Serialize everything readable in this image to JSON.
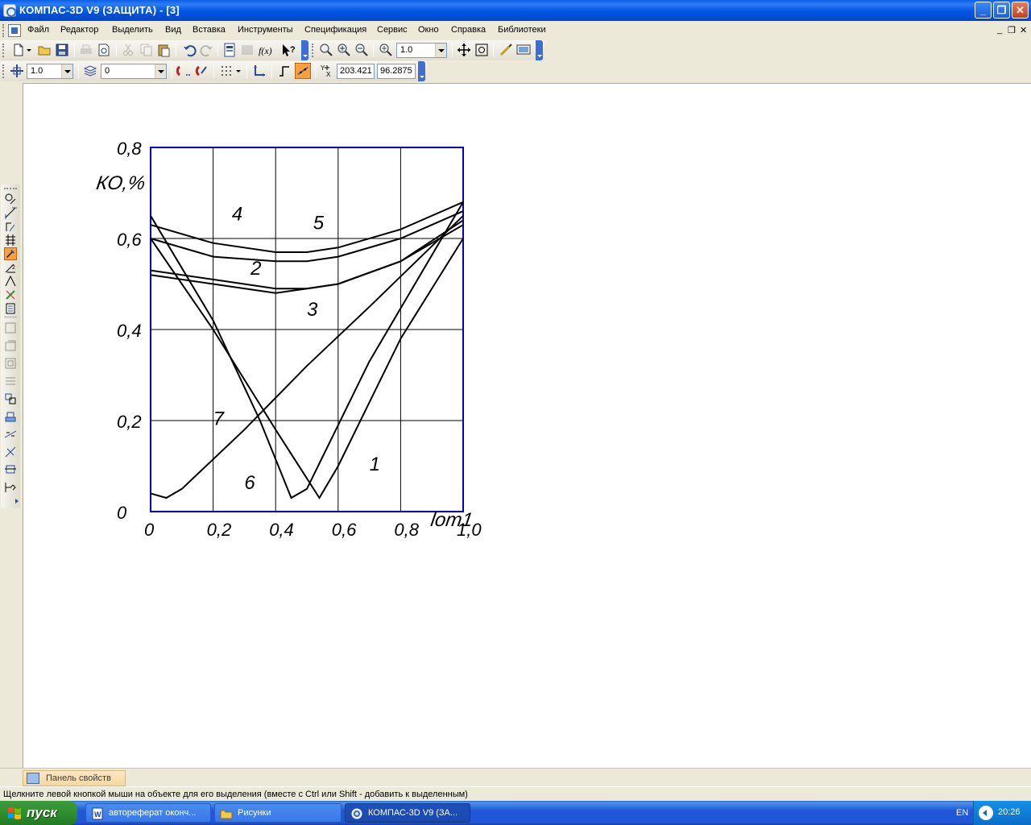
{
  "window": {
    "title": "КОМПАС-3D V9 (ЗАЩИТА) - [3]",
    "buttons": {
      "minimize": "_",
      "restore": "❐",
      "close": "✕"
    }
  },
  "menu": {
    "items": [
      "Файл",
      "Редактор",
      "Выделить",
      "Вид",
      "Вставка",
      "Инструменты",
      "Спецификация",
      "Сервис",
      "Окно",
      "Справка",
      "Библиотеки"
    ]
  },
  "toolbar_standard": {
    "zoom_value": "1.0"
  },
  "toolbar_current_state": {
    "step_value": "1.0",
    "layer_value": "0",
    "coord_x": "203.421",
    "coord_y": "96.2875"
  },
  "properties_panel": {
    "tab_label": "Панель свойств"
  },
  "status_bar": {
    "message": "Щелкните левой кнопкой мыши на объекте для его выделения (вместе с Ctrl или Shift - добавить к выделенным)"
  },
  "taskbar": {
    "start_label": "пуск",
    "tasks": [
      {
        "label": "автореферат оконч..."
      },
      {
        "label": "Рисунки"
      },
      {
        "label": "КОМПАС-3D V9 (ЗА..."
      }
    ],
    "language": "EN",
    "clock": "20:26"
  },
  "chart_data": {
    "type": "line",
    "ylabel": "КО,%",
    "xlabel": "lom1",
    "xlim": [
      0,
      1.0
    ],
    "ylim": [
      0,
      0.8
    ],
    "x_ticks": [
      "0",
      "0,2",
      "0,4",
      "0,6",
      "0,8",
      "1,0"
    ],
    "y_ticks": [
      "0",
      "0,2",
      "0,4",
      "0,6",
      "0,8"
    ],
    "grid": true,
    "series": [
      {
        "name": "1",
        "points": [
          [
            0,
            0.6
          ],
          [
            0.2,
            0.4
          ],
          [
            0.4,
            0.18
          ],
          [
            0.54,
            0.03
          ],
          [
            0.6,
            0.1
          ],
          [
            0.8,
            0.38
          ],
          [
            1.0,
            0.6
          ]
        ]
      },
      {
        "name": "2",
        "points": [
          [
            0,
            0.53
          ],
          [
            0.2,
            0.51
          ],
          [
            0.4,
            0.49
          ],
          [
            0.5,
            0.49
          ],
          [
            0.6,
            0.5
          ],
          [
            0.8,
            0.55
          ],
          [
            1.0,
            0.63
          ]
        ]
      },
      {
        "name": "3",
        "points": [
          [
            0,
            0.52
          ],
          [
            0.2,
            0.5
          ],
          [
            0.4,
            0.48
          ],
          [
            0.5,
            0.49
          ],
          [
            0.6,
            0.5
          ],
          [
            0.8,
            0.55
          ],
          [
            1.0,
            0.64
          ]
        ]
      },
      {
        "name": "4",
        "points": [
          [
            0,
            0.63
          ],
          [
            0.2,
            0.59
          ],
          [
            0.4,
            0.57
          ],
          [
            0.5,
            0.57
          ],
          [
            0.6,
            0.58
          ],
          [
            0.8,
            0.62
          ],
          [
            1.0,
            0.68
          ]
        ]
      },
      {
        "name": "5",
        "points": [
          [
            0,
            0.6
          ],
          [
            0.2,
            0.56
          ],
          [
            0.4,
            0.55
          ],
          [
            0.5,
            0.55
          ],
          [
            0.6,
            0.56
          ],
          [
            0.8,
            0.6
          ],
          [
            1.0,
            0.66
          ]
        ]
      },
      {
        "name": "6",
        "points": [
          [
            0,
            0.65
          ],
          [
            0.2,
            0.42
          ],
          [
            0.35,
            0.2
          ],
          [
            0.45,
            0.03
          ],
          [
            0.5,
            0.05
          ],
          [
            0.7,
            0.33
          ],
          [
            1.0,
            0.68
          ]
        ]
      },
      {
        "name": "7",
        "points": [
          [
            0,
            0.04
          ],
          [
            0.05,
            0.03
          ],
          [
            0.1,
            0.05
          ],
          [
            0.3,
            0.18
          ],
          [
            0.5,
            0.32
          ],
          [
            0.7,
            0.45
          ],
          [
            1.0,
            0.65
          ]
        ]
      }
    ],
    "curve_labels": [
      {
        "text": "1",
        "at": [
          0.7,
          0.09
        ]
      },
      {
        "text": "2",
        "at": [
          0.32,
          0.52
        ]
      },
      {
        "text": "3",
        "at": [
          0.5,
          0.43
        ]
      },
      {
        "text": "4",
        "at": [
          0.26,
          0.64
        ]
      },
      {
        "text": "5",
        "at": [
          0.52,
          0.62
        ]
      },
      {
        "text": "6",
        "at": [
          0.3,
          0.05
        ]
      },
      {
        "text": "7",
        "at": [
          0.2,
          0.19
        ]
      }
    ]
  }
}
